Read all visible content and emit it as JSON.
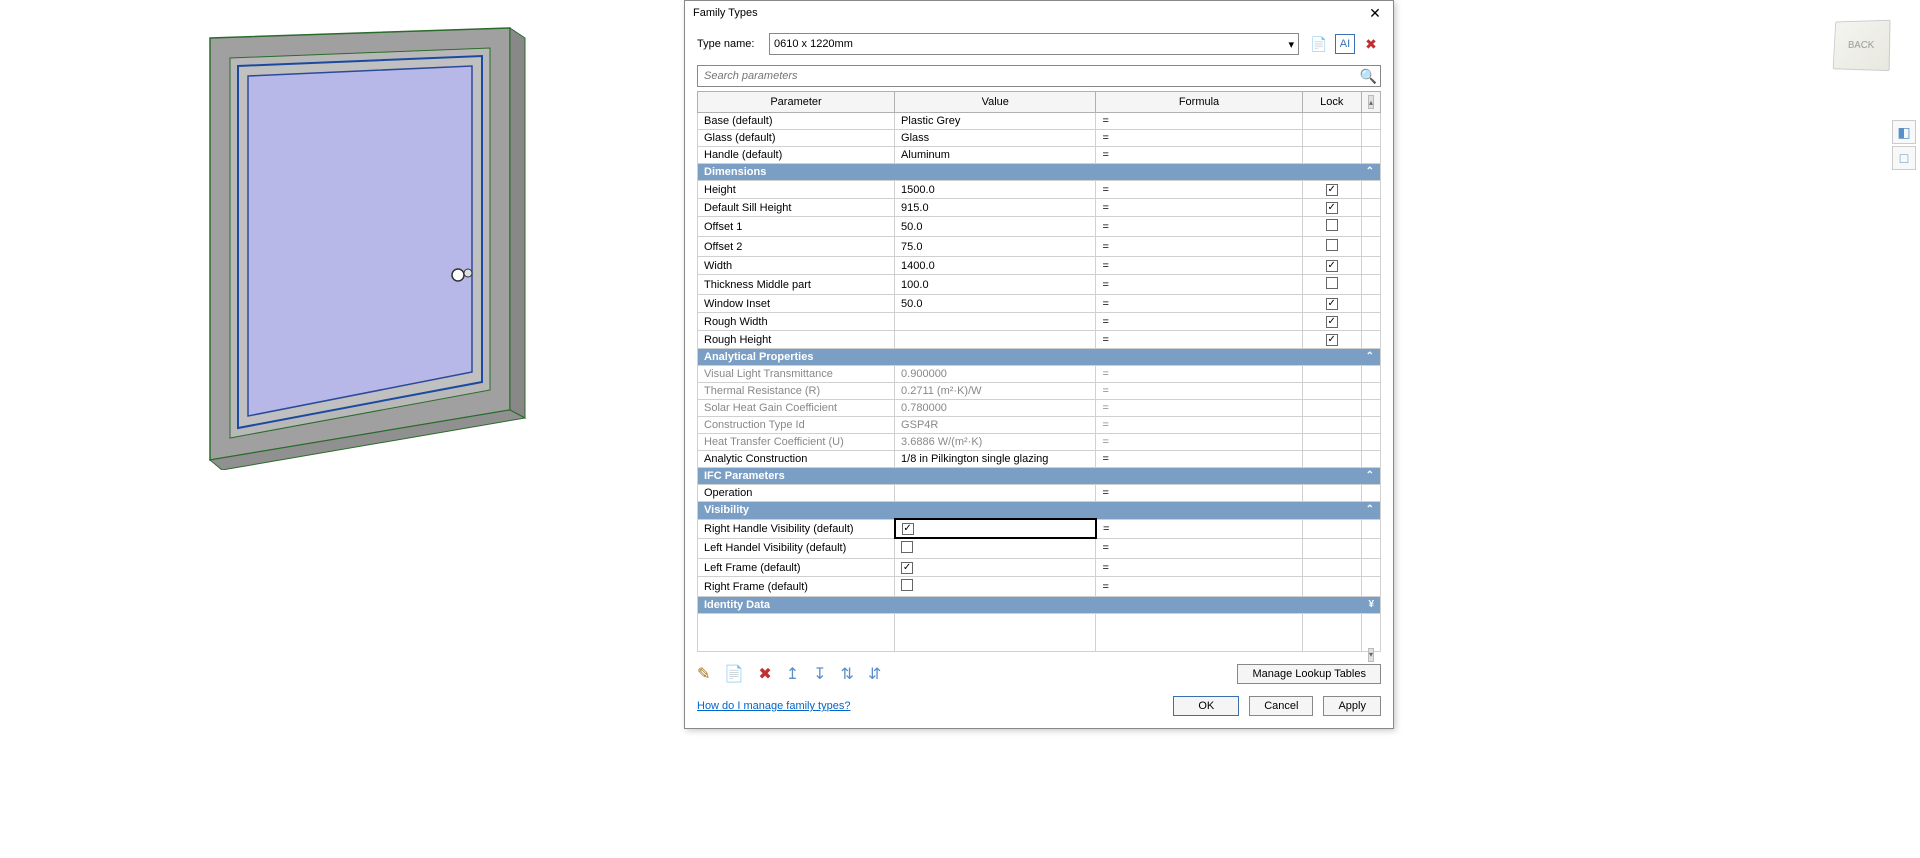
{
  "dialog": {
    "title": "Family Types",
    "type_name_label": "Type name:",
    "type_name_value": "0610 x 1220mm",
    "search_placeholder": "Search parameters",
    "columns": {
      "parameter": "Parameter",
      "value": "Value",
      "formula": "Formula",
      "lock": "Lock"
    },
    "sections": {
      "materials": {
        "rows": [
          {
            "p": "Base (default)",
            "v": "Plastic Grey",
            "f": "="
          },
          {
            "p": "Glass (default)",
            "v": "Glass",
            "f": "="
          },
          {
            "p": "Handle (default)",
            "v": "Aluminum",
            "f": "="
          }
        ]
      },
      "dimensions": {
        "title": "Dimensions",
        "rows": [
          {
            "p": "Height",
            "v": "1500.0",
            "f": "=",
            "lock": true
          },
          {
            "p": "Default Sill Height",
            "v": "915.0",
            "f": "=",
            "lock": true
          },
          {
            "p": "Offset 1",
            "v": "50.0",
            "f": "=",
            "lock": false
          },
          {
            "p": "Offset 2",
            "v": "75.0",
            "f": "=",
            "lock": false
          },
          {
            "p": "Width",
            "v": "1400.0",
            "f": "=",
            "lock": true
          },
          {
            "p": "Thickness Middle part",
            "v": "100.0",
            "f": "=",
            "lock": false
          },
          {
            "p": "Window Inset",
            "v": "50.0",
            "f": "=",
            "lock": true
          },
          {
            "p": "Rough Width",
            "v": "",
            "f": "=",
            "lock": true
          },
          {
            "p": "Rough Height",
            "v": "",
            "f": "=",
            "lock": true
          }
        ]
      },
      "analytical": {
        "title": "Analytical Properties",
        "rows": [
          {
            "p": "Visual Light Transmittance",
            "v": "0.900000",
            "f": "=",
            "ro": true
          },
          {
            "p": "Thermal Resistance (R)",
            "v": "0.2711 (m²·K)/W",
            "f": "=",
            "ro": true
          },
          {
            "p": "Solar Heat Gain Coefficient",
            "v": "0.780000",
            "f": "=",
            "ro": true
          },
          {
            "p": "Construction Type Id",
            "v": "GSP4R",
            "f": "=",
            "ro": true
          },
          {
            "p": "Heat Transfer Coefficient (U)",
            "v": "3.6886 W/(m²·K)",
            "f": "=",
            "ro": true
          },
          {
            "p": "Analytic Construction",
            "v": "1/8 in Pilkington single glazing",
            "f": "="
          }
        ]
      },
      "ifc": {
        "title": "IFC Parameters",
        "rows": [
          {
            "p": "Operation",
            "v": "",
            "f": "="
          }
        ]
      },
      "visibility": {
        "title": "Visibility",
        "rows": [
          {
            "p": "Right Handle Visibility (default)",
            "vcheck": true,
            "f": "=",
            "selected": true
          },
          {
            "p": "Left Handel Visibility (default)",
            "vcheck": false,
            "f": "="
          },
          {
            "p": "Left Frame (default)",
            "vcheck": true,
            "f": "="
          },
          {
            "p": "Right Frame (default)",
            "vcheck": false,
            "f": "="
          }
        ]
      },
      "identity": {
        "title": "Identity Data"
      }
    },
    "help_link": "How do I manage family types?",
    "buttons": {
      "lookup": "Manage Lookup Tables",
      "ok": "OK",
      "cancel": "Cancel",
      "apply": "Apply"
    }
  },
  "viewcube": {
    "label": "BACK"
  }
}
